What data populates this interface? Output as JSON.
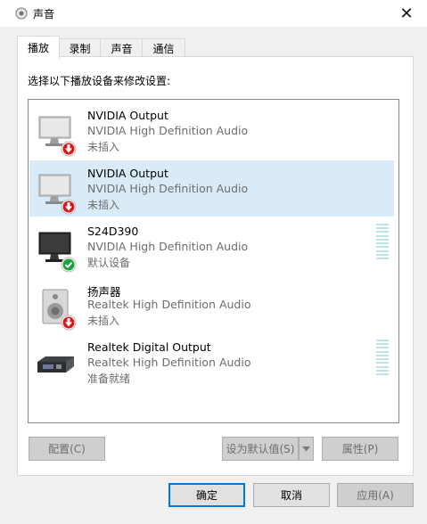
{
  "window": {
    "title": "声音",
    "close_glyph": "✕"
  },
  "tabs": [
    {
      "label": "播放",
      "active": true
    },
    {
      "label": "录制",
      "active": false
    },
    {
      "label": "声音",
      "active": false
    },
    {
      "label": "通信",
      "active": false
    }
  ],
  "instruction": "选择以下播放设备来修改设置:",
  "devices": [
    {
      "name": "NVIDIA Output",
      "driver": "NVIDIA High Definition Audio",
      "status": "未插入",
      "icon": "monitor-icon",
      "badge": "unplugged-badge-icon"
    },
    {
      "name": "NVIDIA Output",
      "driver": "NVIDIA High Definition Audio",
      "status": "未插入",
      "icon": "monitor-icon",
      "badge": "unplugged-badge-icon",
      "selected": true
    },
    {
      "name": "S24D390",
      "driver": "NVIDIA High Definition Audio",
      "status": "默认设备",
      "icon": "monitor-icon",
      "badge": "default-check-icon",
      "meter": true
    },
    {
      "name": "扬声器",
      "driver": "Realtek High Definition Audio",
      "status": "未插入",
      "icon": "speaker-icon",
      "badge": "unplugged-badge-icon"
    },
    {
      "name": "Realtek Digital Output",
      "driver": "Realtek High Definition Audio",
      "status": "准备就绪",
      "icon": "digital-output-icon",
      "meter": true
    }
  ],
  "buttons": {
    "configure": "配置(C)",
    "set_default": "设为默认值(S)",
    "properties": "属性(P)",
    "ok": "确定",
    "cancel": "取消",
    "apply": "应用(A)"
  },
  "colors": {
    "selected_bg": "#d9ebf9",
    "accent": "#0078d7",
    "unplugged_red": "#d61a1a",
    "default_green": "#1aa33b"
  }
}
